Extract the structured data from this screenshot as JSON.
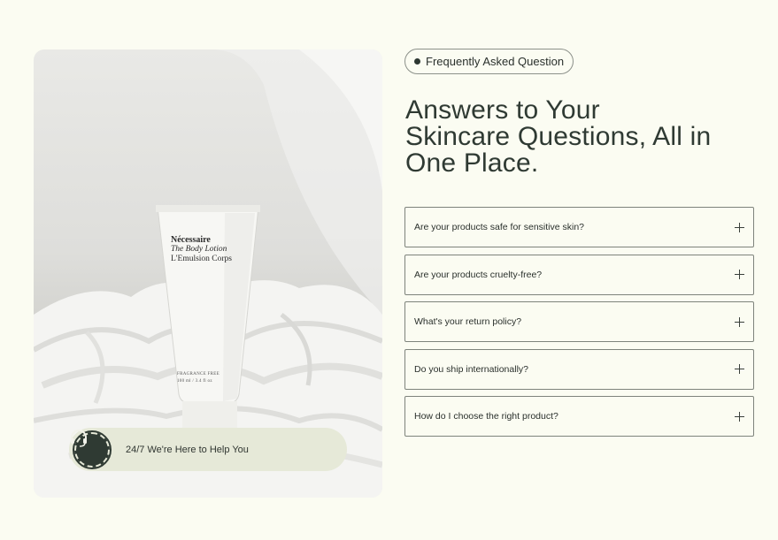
{
  "badge": {
    "label": "Frequently Asked Question"
  },
  "heading": {
    "line1": "Answers to Your",
    "line2": "Skincare Questions, All in",
    "line3": "One Place."
  },
  "faq": [
    {
      "question": "Are your products safe for sensitive skin?",
      "icon": "plus-icon"
    },
    {
      "question": "Are your products cruelty-free?",
      "icon": "plus-icon"
    },
    {
      "question": "What's your return policy?",
      "icon": "plus-icon"
    },
    {
      "question": "Do you ship internationally?",
      "icon": "plus-icon"
    },
    {
      "question": "How do I choose the right product?",
      "icon": "plus-icon"
    }
  ],
  "product": {
    "brand": "Nécessaire",
    "line1": "The Body Lotion",
    "line2": "L'Emulsion Corps",
    "small1": "FRAGRANCE FREE",
    "small2": "100 ml / 3.4 fl oz"
  },
  "support": {
    "label": "24/7 We're Here to Help You",
    "icon": "headset-icon"
  },
  "colors": {
    "background": "#fbfcf2",
    "accent_dark": "#2f3a33",
    "pill": "#e6e9d8"
  }
}
